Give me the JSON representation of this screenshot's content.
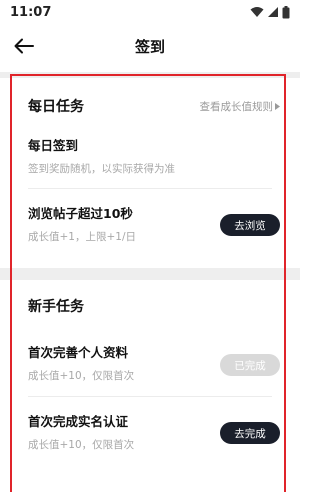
{
  "status_bar": {
    "time": "11:07",
    "icons": [
      "wifi-icon",
      "signal-icon",
      "battery-icon"
    ]
  },
  "header": {
    "title": "签到",
    "back_icon": "arrow-left-icon"
  },
  "daily": {
    "title": "每日任务",
    "rule_link": "查看成长值规则",
    "tasks": [
      {
        "title": "每日签到",
        "desc": "签到奖励随机，以实际获得为准"
      },
      {
        "title": "浏览帖子超过10秒",
        "desc": "成长值+1，上限+1/日",
        "button": "去浏览"
      }
    ]
  },
  "newbie": {
    "title": "新手任务",
    "tasks": [
      {
        "title": "首次完善个人资料",
        "desc": "成长值+10，仅限首次",
        "button": "已完成",
        "status": "done"
      },
      {
        "title": "首次完成实名认证",
        "desc": "成长值+10，仅限首次",
        "button": "去完成"
      }
    ]
  },
  "colors": {
    "primary_button": "#1a1f2b",
    "done_button": "#d9d9d9",
    "highlight": "#e0242a",
    "section_gap": "#eeeeee"
  }
}
